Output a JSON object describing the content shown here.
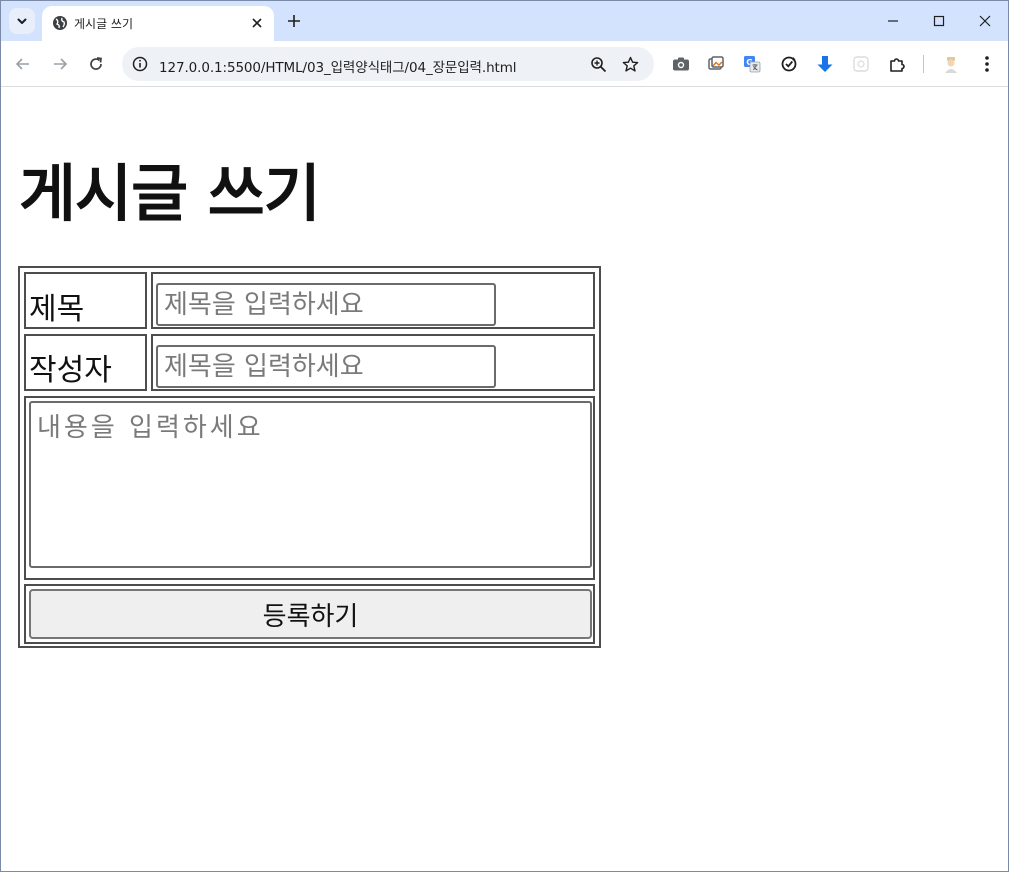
{
  "browser": {
    "tab": {
      "title": "게시글 쓰기"
    },
    "address": {
      "url": "127.0.0.1:5500/HTML/03_입력양식태그/04_장문입력.html"
    }
  },
  "page": {
    "heading": "게시글 쓰기",
    "form": {
      "title_label": "제목",
      "title_placeholder": "제목을 입력하세요",
      "author_label": "작성자",
      "author_placeholder": "제목을 입력하세요",
      "content_placeholder": "내용을 입력하세요",
      "submit_label": "등록하기"
    }
  }
}
